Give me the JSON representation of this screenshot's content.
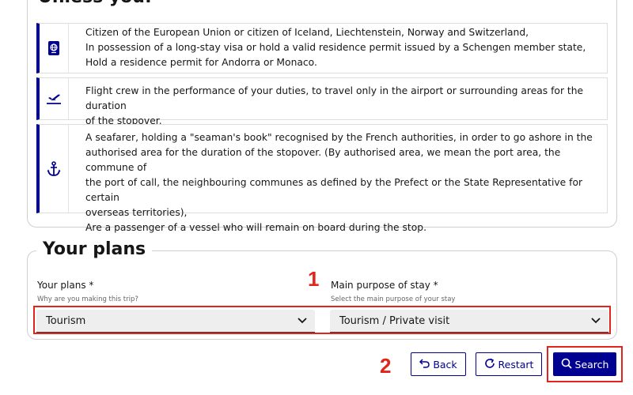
{
  "top_section": {
    "heading": "Unless you:",
    "items": [
      {
        "icon": "passport-icon",
        "lines": [
          "Citizen of the European Union or citizen of Iceland, Liechtenstein, Norway and Switzerland,",
          "In possession of a long-stay visa or hold a valid residence permit issued by a Schengen member state,",
          "Hold a residence permit for Andorra or Monaco."
        ]
      },
      {
        "icon": "plane-icon",
        "lines": [
          "Flight crew in the performance of your duties, to travel only in the airport or surrounding areas for the duration",
          "of the stopover."
        ]
      },
      {
        "icon": "anchor-icon",
        "lines": [
          "A seafarer, holding a \"seaman's book\" recognised by the French authorities, in order to go ashore in the",
          "authorised area for the duration of the stopover. (By authorised area, we mean the port area, the commune of",
          "the port of call, the neighbouring communes as defined by the Prefect or the State Representative for certain",
          "overseas territories),",
          "Are a passenger of a vessel who will remain on board during the stop."
        ]
      }
    ]
  },
  "plans_section": {
    "heading": "Your plans",
    "plans_field": {
      "label": "Your plans *",
      "hint": "Why are you making this trip?",
      "value": "Tourism"
    },
    "purpose_field": {
      "label": "Main purpose of stay *",
      "hint": "Select the main purpose of your stay",
      "value": "Tourism / Private visit"
    }
  },
  "buttons": {
    "back": "Back",
    "restart": "Restart",
    "search": "Search"
  },
  "annotations": {
    "step1": "1",
    "step2": "2"
  },
  "colors": {
    "accent": "#000091",
    "annotation_red": "#e1251b"
  }
}
